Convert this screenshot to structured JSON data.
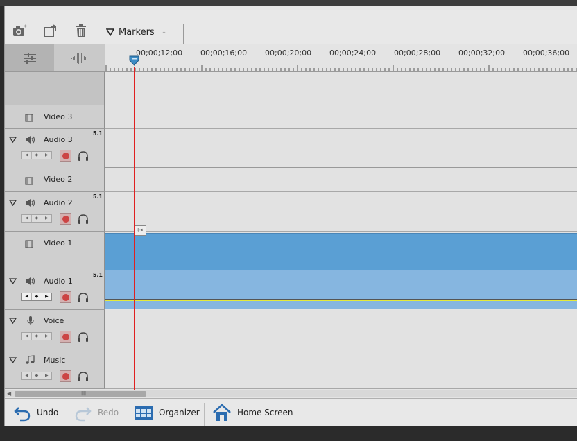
{
  "toolbar": {
    "markers_label": "Markers",
    "icons": [
      "camera-icon",
      "export-frame-icon",
      "trash-icon",
      "marker-icon"
    ]
  },
  "ruler": {
    "labels": [
      "00;00;12;00",
      "00;00;16;00",
      "00;00;20;00",
      "00;00;24;00",
      "00;00;28;00",
      "00;00;32;00",
      "00;00;36;00"
    ]
  },
  "tracks": {
    "video3": {
      "name": "Video 3"
    },
    "audio3": {
      "name": "Audio 3",
      "channels": "5.1"
    },
    "video2": {
      "name": "Video 2"
    },
    "audio2": {
      "name": "Audio 2",
      "channels": "5.1"
    },
    "video1": {
      "name": "Video 1"
    },
    "audio1": {
      "name": "Audio 1",
      "channels": "5.1"
    },
    "voice": {
      "name": "Voice"
    },
    "music": {
      "name": "Music"
    }
  },
  "footer": {
    "undo": "Undo",
    "redo": "Redo",
    "organizer": "Organizer",
    "home": "Home Screen"
  },
  "colors": {
    "clip_video": "#5a9fd4",
    "clip_audio": "#86b6e0",
    "playhead": "#e02020",
    "accent_icon": "#2b6cb0"
  }
}
